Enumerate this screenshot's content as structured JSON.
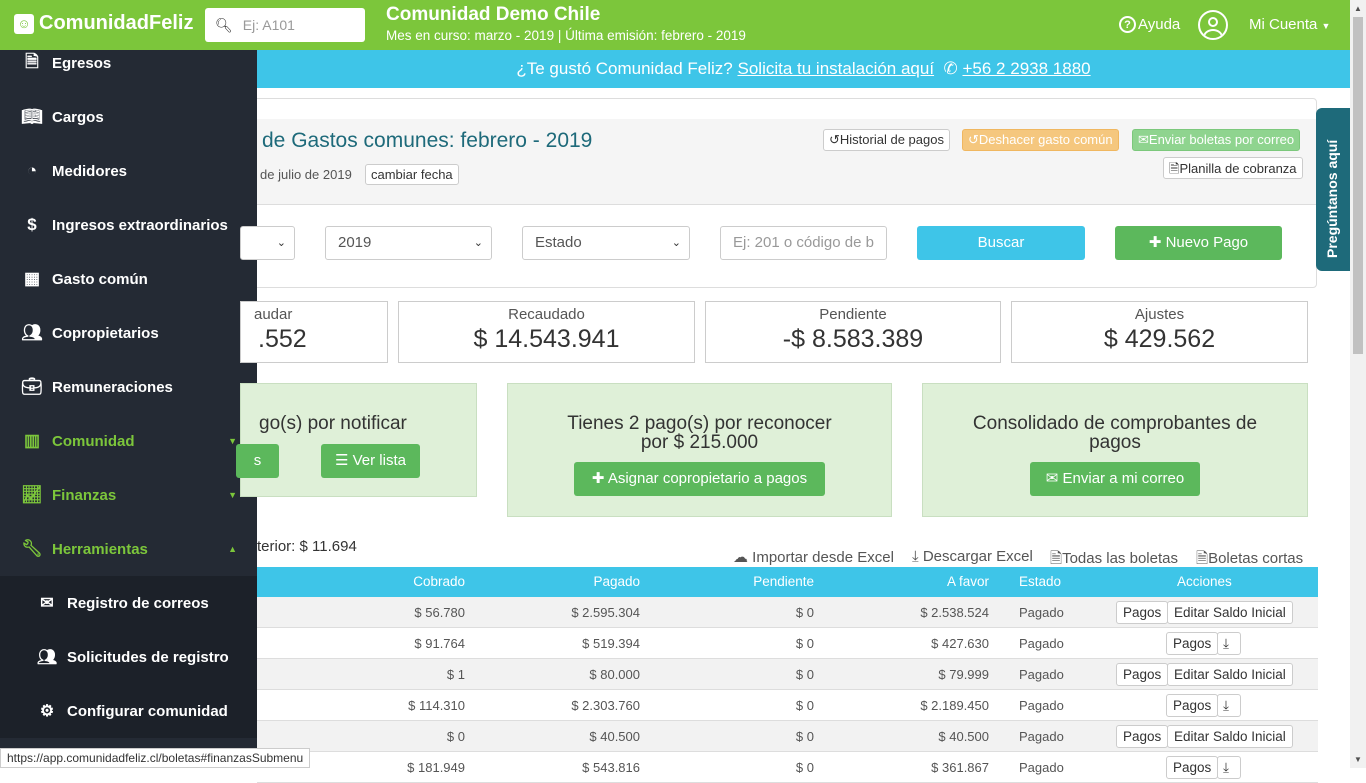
{
  "topbar": {
    "logo": "ComunidadFeliz",
    "search_placeholder": "Ej: A101",
    "community_name": "Comunidad Demo Chile",
    "period": "Mes en curso: marzo - 2019 | Última emisión: febrero - 2019",
    "help": "Ayuda",
    "account": "Mi Cuenta"
  },
  "promo": {
    "text": "¿Te gustó Comunidad Feliz?",
    "link": "Solicita tu instalación aquí",
    "phone": "+56 2 2938 1880"
  },
  "sidebar": {
    "items": [
      {
        "label": "Egresos",
        "icon": "document-icon"
      },
      {
        "label": "Cargos",
        "icon": "book-icon"
      },
      {
        "label": "Medidores",
        "icon": "gauge-icon"
      },
      {
        "label": "Ingresos extraordinarios",
        "icon": "dollar-icon"
      },
      {
        "label": "Gasto común",
        "icon": "calculator-icon"
      },
      {
        "label": "Copropietarios",
        "icon": "users-icon"
      },
      {
        "label": "Remuneraciones",
        "icon": "briefcase-icon"
      },
      {
        "label": "Comunidad",
        "icon": "building-icon"
      },
      {
        "label": "Finanzas",
        "icon": "chart-icon"
      },
      {
        "label": "Herramientas",
        "icon": "wrench-icon"
      }
    ],
    "submenu": [
      {
        "label": "Registro de correos",
        "icon": "envelope-icon"
      },
      {
        "label": "Solicitudes de registro",
        "icon": "users-icon"
      },
      {
        "label": "Configurar comunidad",
        "icon": "gear-icon"
      }
    ]
  },
  "header": {
    "title": "de Gastos comunes: febrero - 2019",
    "date": "de julio de 2019",
    "change_date": "cambiar fecha",
    "historial": "Historial de pagos",
    "deshacer": "Deshacer gasto común",
    "enviar": "Enviar boletas por correo",
    "planilla": "Planilla de cobranza"
  },
  "filters": {
    "year": "2019",
    "estado": "Estado",
    "search_placeholder": "Ej: 201 o código de b",
    "buscar": "Buscar",
    "nuevo_pago": "Nuevo Pago"
  },
  "stats": [
    {
      "label": "audar",
      "value": ".552"
    },
    {
      "label": "Recaudado",
      "value": "$ 14.543.941"
    },
    {
      "label": "Pendiente",
      "value": "-$ 8.583.389"
    },
    {
      "label": "Ajustes",
      "value": "$ 429.562"
    }
  ],
  "boxes": {
    "notify_title": "go(s) por notificar",
    "notify_btn_partial": "s",
    "ver_lista": "Ver lista",
    "recognize_title1": "Tienes 2 pago(s) por reconocer",
    "recognize_title2": "por $ 215.000",
    "assign_btn": "Asignar copropietario a pagos",
    "consolidated_title1": "Consolidado de comprobantes de",
    "consolidated_title2": "pagos",
    "send_mail": "Enviar a mi correo"
  },
  "tools": {
    "previous": "terior: $ 11.694",
    "import": "Importar desde Excel",
    "download": "Descargar Excel",
    "all_receipts": "Todas las boletas",
    "short_receipts": "Boletas cortas"
  },
  "table": {
    "headers": [
      "Cobrado",
      "Pagado",
      "Pendiente",
      "A favor",
      "Estado",
      "Acciones"
    ],
    "rows": [
      {
        "cobrado": "$ 56.780",
        "pagado": "$ 2.595.304",
        "pendiente": "$ 0",
        "afavor": "$ 2.538.524",
        "estado": "Pagado",
        "type": "edit"
      },
      {
        "cobrado": "$ 91.764",
        "pagado": "$ 519.394",
        "pendiente": "$ 0",
        "afavor": "$ 427.630",
        "estado": "Pagado",
        "type": "download"
      },
      {
        "cobrado": "$ 1",
        "pagado": "$ 80.000",
        "pendiente": "$ 0",
        "afavor": "$ 79.999",
        "estado": "Pagado",
        "type": "edit"
      },
      {
        "cobrado": "$ 114.310",
        "pagado": "$ 2.303.760",
        "pendiente": "$ 0",
        "afavor": "$ 2.189.450",
        "estado": "Pagado",
        "type": "download"
      },
      {
        "cobrado": "$ 0",
        "pagado": "$ 40.500",
        "pendiente": "$ 0",
        "afavor": "$ 40.500",
        "estado": "Pagado",
        "type": "edit"
      },
      {
        "cobrado": "$ 181.949",
        "pagado": "$ 543.816",
        "pendiente": "$ 0",
        "afavor": "$ 361.867",
        "estado": "Pagado",
        "type": "download"
      }
    ],
    "pagos_label": "Pagos",
    "edit_label": "Editar Saldo Inicial"
  },
  "ask_tab": "Pregúntanos aquí",
  "status_url": "https://app.comunidadfeliz.cl/boletas#finanzasSubmenu",
  "colors": {
    "brand": "#7cc63b",
    "info": "#3ec5e8",
    "sidebar": "#242a34",
    "success": "#5cb85c",
    "teal": "#1e6a7a"
  }
}
